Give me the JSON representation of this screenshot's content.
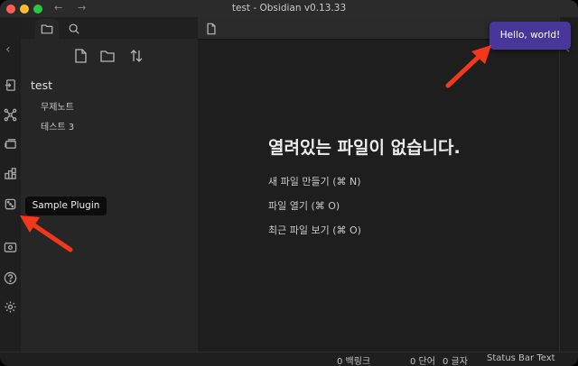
{
  "window": {
    "title": "test - Obsidian v0.13.33",
    "nav_back": "←",
    "nav_forward": "→"
  },
  "ribbon": {
    "icons": [
      "open-another-vault-icon",
      "graph-view-icon",
      "slides-icon",
      "daily-notes-icon",
      "sample-plugin-dice-icon",
      "command-palette-icon",
      "help-icon",
      "settings-icon"
    ]
  },
  "sidebar": {
    "tabs": [
      "file-explorer-icon",
      "search-icon"
    ],
    "actions": [
      "new-note-icon",
      "new-folder-icon",
      "sort-icon"
    ],
    "vault_name": "test",
    "files": [
      "무제노트",
      "테스트 3"
    ]
  },
  "main": {
    "empty_title": "열려있는 파일이 없습니다.",
    "actions": [
      "새 파일 만들기 (⌘ N)",
      "파일 열기 (⌘ O)",
      "최근 파일 보기 (⌘ O)"
    ]
  },
  "notice": {
    "text": "Hello, world!"
  },
  "tooltip": {
    "text": "Sample Plugin"
  },
  "statusbar": {
    "backlinks": "0 백링크",
    "word_count": "0 단어",
    "char_count": "0 글자",
    "plugin_text": "Status Bar Text"
  },
  "colors": {
    "accent": "#483699",
    "annotation_arrow": "#f2381c"
  }
}
